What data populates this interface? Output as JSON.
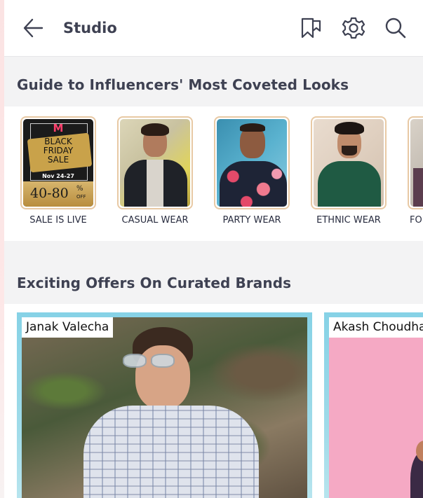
{
  "header": {
    "title": "Studio",
    "back_icon": "arrow-left-icon",
    "icons": [
      "bookmark-icon",
      "gear-icon",
      "search-icon"
    ]
  },
  "sections": {
    "looks_title": "Guide to Influencers' Most Coveted Looks",
    "offers_title": "Exciting Offers On Curated Brands"
  },
  "looks": [
    {
      "label": "SALE IS LIVE"
    },
    {
      "label": "CASUAL WEAR"
    },
    {
      "label": "PARTY WEAR"
    },
    {
      "label": "ETHNIC WEAR"
    },
    {
      "label": "FO"
    }
  ],
  "sale_banner": {
    "logo": "M",
    "line1": "BLACK",
    "line2": "FRIDAY",
    "line3": "SALE",
    "dates": "Nov 24-27",
    "discount": "40-80",
    "percent": "%",
    "off": "OFF"
  },
  "offers": [
    {
      "name": "Janak Valecha"
    },
    {
      "name": "Akash Choudha"
    }
  ],
  "colors": {
    "text_primary": "#3e4152",
    "frame_border": "#e8c9a4",
    "card_border": "#86d2e6",
    "page_bg": "#f3f3f4"
  }
}
